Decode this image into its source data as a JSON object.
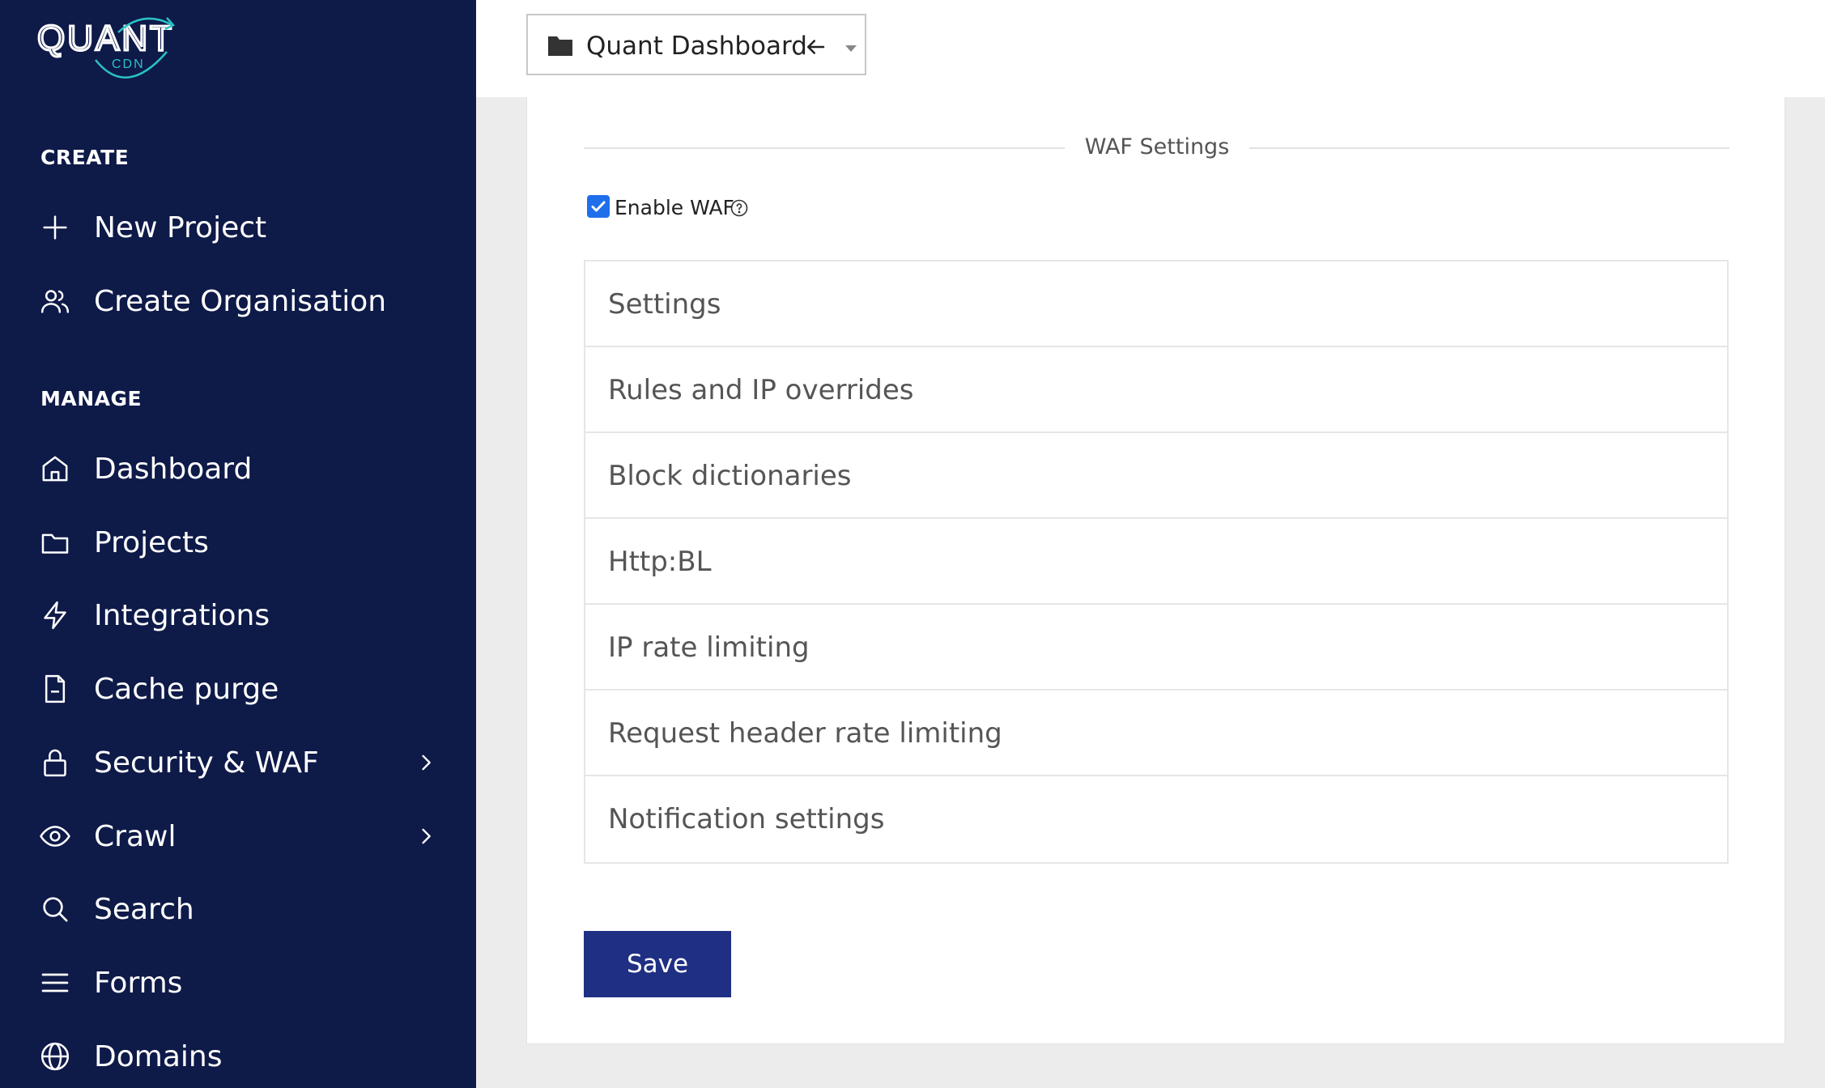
{
  "brand": {
    "logo_main": "QUANT",
    "logo_sub": "CDN",
    "colors": {
      "sidebar_bg": "#0e1a48",
      "accent": "#1f2f84",
      "logo_accent": "#29c2c7",
      "checkbox": "#1f6feb"
    }
  },
  "sidebar": {
    "create_label": "CREATE",
    "manage_label": "MANAGE",
    "create_items": [
      {
        "label": "New Project",
        "icon": "plus-icon"
      },
      {
        "label": "Create Organisation",
        "icon": "users-icon"
      }
    ],
    "manage_items": [
      {
        "label": "Dashboard",
        "icon": "home-icon"
      },
      {
        "label": "Projects",
        "icon": "folder-icon"
      },
      {
        "label": "Integrations",
        "icon": "lightning-icon"
      },
      {
        "label": "Cache purge",
        "icon": "document-icon"
      },
      {
        "label": "Security & WAF",
        "icon": "lock-icon",
        "has_submenu": true
      },
      {
        "label": "Crawl",
        "icon": "eye-icon",
        "has_submenu": true
      },
      {
        "label": "Search",
        "icon": "search-icon"
      },
      {
        "label": "Forms",
        "icon": "menu-lines-icon"
      },
      {
        "label": "Domains",
        "icon": "globe-icon"
      }
    ]
  },
  "topbar": {
    "project_selector": {
      "value": "Quant Dashboard",
      "icon": "folder-icon"
    }
  },
  "main": {
    "section_title": "WAF Settings",
    "enable_waf": {
      "label": "Enable WAF",
      "checked": true
    },
    "accordion": [
      {
        "label": "Settings"
      },
      {
        "label": "Rules and IP overrides"
      },
      {
        "label": "Block dictionaries"
      },
      {
        "label": "Http:BL"
      },
      {
        "label": "IP rate limiting"
      },
      {
        "label": "Request header rate limiting"
      },
      {
        "label": "Notification settings"
      }
    ],
    "save_label": "Save"
  }
}
